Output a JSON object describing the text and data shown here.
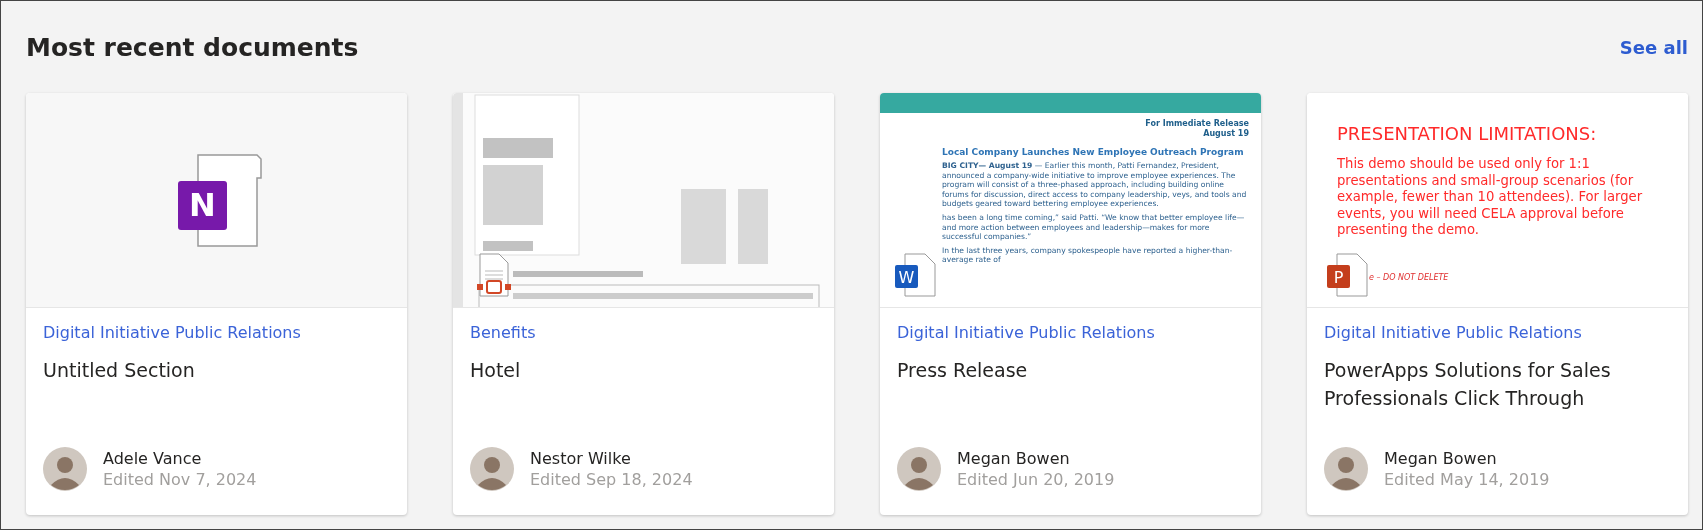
{
  "header": {
    "title": "Most recent documents",
    "link": "See all"
  },
  "documents": [
    {
      "kind": "notebook",
      "icon_letter": "N",
      "category": "Digital Initiative Public Relations",
      "title": "Untitled Section",
      "author": "Adele Vance",
      "edited": "Edited Nov 7, 2024"
    },
    {
      "kind": "scan",
      "category": "Benefits",
      "title": "Hotel",
      "author": "Nestor Wilke",
      "edited": "Edited Sep 18, 2024"
    },
    {
      "kind": "word",
      "icon_letter": "W",
      "category": "Digital Initiative Public Relations",
      "title": "Press Release",
      "author": "Megan Bowen",
      "edited": "Edited Jun 20, 2019",
      "preview": {
        "release_lines": [
          "For Immediate Release",
          "August 19"
        ],
        "headline": "Local Company Launches New Employee Outreach Program",
        "paragraphs": [
          "**BIG CITY— August 19** — Earlier this month, Patti Fernandez, President, announced a company-wide initiative to improve employee experiences. The program will consist of a three-phased approach, including building online forums for discussion, direct access to company leadership, veys, and tools and budgets geared toward bettering employee experiences.",
          "has been a long time coming,” said Patti. “We know that better employee life—and more action between employees and leadership—makes for more successful companies.”",
          "In the last three years, company spokespeople have reported a higher-than-average rate of"
        ]
      }
    },
    {
      "kind": "slides",
      "icon_letter": "P",
      "category": "Digital Initiative Public Relations",
      "title": "PowerApps Solutions for Sales Professionals Click Through",
      "author": "Megan Bowen",
      "edited": "Edited May 14, 2019",
      "preview": {
        "heading": "PRESENTATION LIMITATIONS:",
        "body": "This demo should be used only for 1:1 presentations and small-group scenarios (for example, fewer than 10 attendees). For larger events, you will need CELA approval before presenting the demo.",
        "footer": "e – DO NOT DELETE"
      }
    }
  ]
}
